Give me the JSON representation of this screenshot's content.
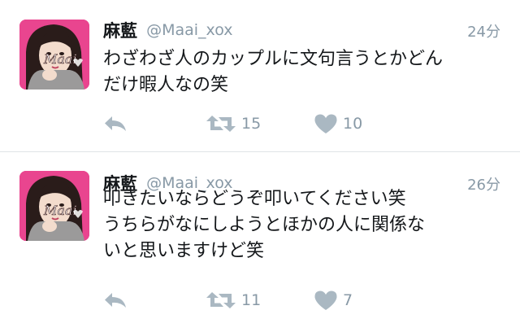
{
  "tweets": [
    {
      "display_name": "麻藍",
      "handle": "@Maai_xox",
      "time": "24分",
      "text_lines": [
        "わざわざ人のカップルに文句言うとかどん",
        "だけ暇人なの笑"
      ],
      "retweet_count": "15",
      "like_count": "10",
      "avatar_sticker_text": "Maai"
    },
    {
      "display_name": "麻藍",
      "handle": "@Maai_xox",
      "time": "26分",
      "text_lines": [
        "叩きたいならどうぞ叩いてください笑",
        "うちらがなにしようとほかの人に関係な",
        "いと思いますけど笑"
      ],
      "retweet_count": "11",
      "like_count": "7",
      "avatar_sticker_text": "Maai"
    }
  ],
  "icons": {
    "reply": "reply-icon",
    "retweet": "retweet-icon",
    "like": "heart-icon"
  },
  "colors": {
    "text": "#14171a",
    "secondary": "#8899a6",
    "icon": "#aab8c2",
    "divider": "#dfe3e7",
    "avatar_bg": "#e9458f"
  }
}
